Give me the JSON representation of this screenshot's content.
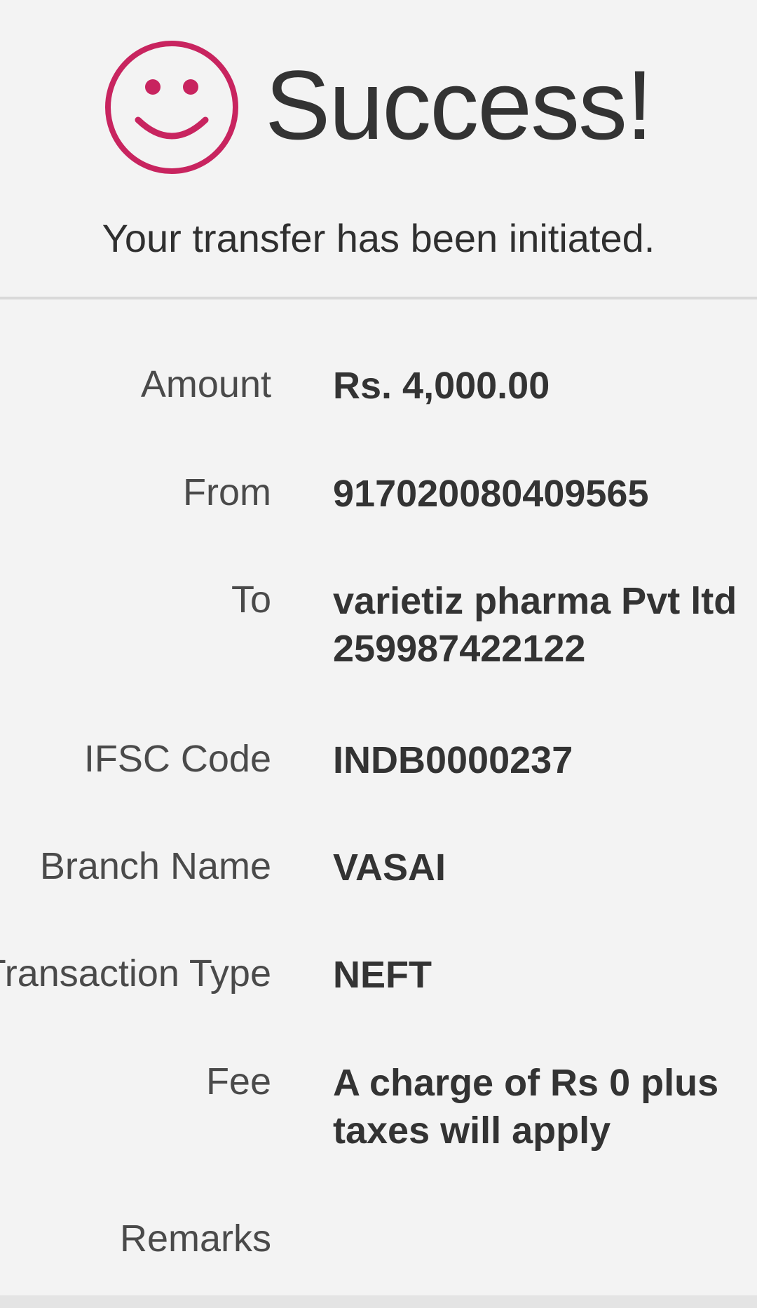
{
  "header": {
    "title": "Success!",
    "subtitle": "Your transfer has been initiated.",
    "icon": "smiley-icon",
    "accent_color": "#c8245f"
  },
  "details": {
    "amount": {
      "label": "Amount",
      "value": "Rs. 4,000.00"
    },
    "from": {
      "label": "From",
      "value": "917020080409565"
    },
    "to": {
      "label": "To",
      "value_line1": "varietiz pharma Pvt ltd",
      "value_line2": "259987422122"
    },
    "ifsc": {
      "label": "IFSC Code",
      "value": "INDB0000237"
    },
    "branch": {
      "label": "Branch Name",
      "value": "VASAI"
    },
    "transaction_type": {
      "label": "Transaction Type",
      "value": "NEFT"
    },
    "fee": {
      "label": "Fee",
      "value_line1": "A charge of Rs 0 plus",
      "value_line2": "taxes will apply"
    },
    "remarks": {
      "label": "Remarks",
      "value": ""
    }
  }
}
